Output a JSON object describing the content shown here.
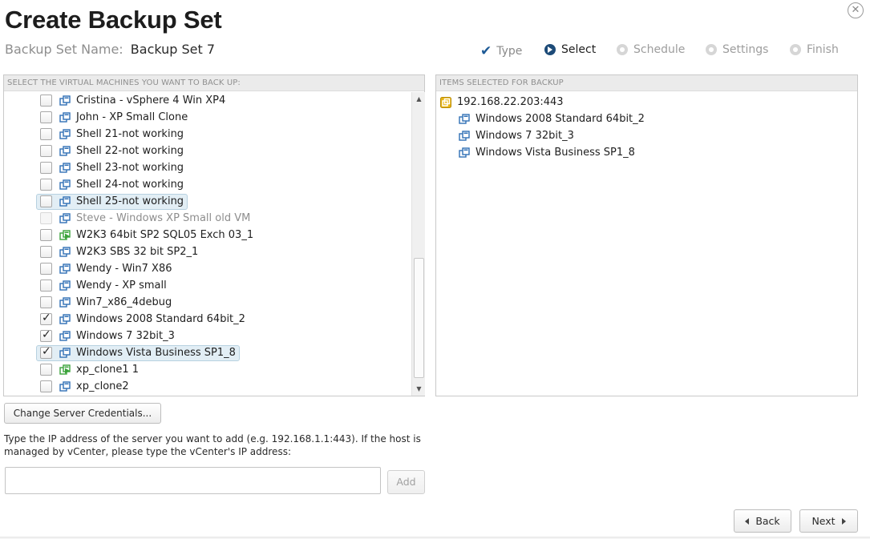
{
  "title": "Create Backup Set",
  "backup_set": {
    "label": "Backup Set Name:",
    "value": "Backup Set 7"
  },
  "steps": [
    {
      "label": "Type",
      "state": "done"
    },
    {
      "label": "Select",
      "state": "active"
    },
    {
      "label": "Schedule",
      "state": "pending"
    },
    {
      "label": "Settings",
      "state": "pending"
    },
    {
      "label": "Finish",
      "state": "pending"
    }
  ],
  "left_panel": {
    "header": "SELECT THE VIRTUAL MACHINES YOU WANT TO BACK UP:",
    "vms": [
      {
        "label": "Cristina - vSphere 4 Win XP4",
        "checked": false,
        "icon": "vm-off-icon",
        "highlight": false,
        "disabled": false
      },
      {
        "label": "John - XP Small Clone",
        "checked": false,
        "icon": "vm-off-icon",
        "highlight": false,
        "disabled": false
      },
      {
        "label": "Shell 21-not working",
        "checked": false,
        "icon": "vm-off-icon",
        "highlight": false,
        "disabled": false
      },
      {
        "label": "Shell 22-not working",
        "checked": false,
        "icon": "vm-off-icon",
        "highlight": false,
        "disabled": false
      },
      {
        "label": "Shell 23-not working",
        "checked": false,
        "icon": "vm-off-icon",
        "highlight": false,
        "disabled": false
      },
      {
        "label": "Shell 24-not working",
        "checked": false,
        "icon": "vm-off-icon",
        "highlight": false,
        "disabled": false
      },
      {
        "label": "Shell 25-not working",
        "checked": false,
        "icon": "vm-off-icon",
        "highlight": true,
        "disabled": false
      },
      {
        "label": "Steve - Windows XP Small old VM",
        "checked": false,
        "icon": "vm-off-icon",
        "highlight": false,
        "disabled": true
      },
      {
        "label": "W2K3 64bit SP2 SQL05 Exch 03_1",
        "checked": false,
        "icon": "vm-running-icon",
        "highlight": false,
        "disabled": false
      },
      {
        "label": "W2K3 SBS 32 bit SP2_1",
        "checked": false,
        "icon": "vm-off-icon",
        "highlight": false,
        "disabled": false
      },
      {
        "label": "Wendy - Win7 X86",
        "checked": false,
        "icon": "vm-off-icon",
        "highlight": false,
        "disabled": false
      },
      {
        "label": "Wendy - XP small",
        "checked": false,
        "icon": "vm-off-icon",
        "highlight": false,
        "disabled": false
      },
      {
        "label": "Win7_x86_4debug",
        "checked": false,
        "icon": "vm-off-icon",
        "highlight": false,
        "disabled": false
      },
      {
        "label": "Windows 2008 Standard 64bit_2",
        "checked": true,
        "icon": "vm-off-icon",
        "highlight": false,
        "disabled": false
      },
      {
        "label": "Windows 7 32bit_3",
        "checked": true,
        "icon": "vm-off-icon",
        "highlight": false,
        "disabled": false
      },
      {
        "label": "Windows Vista Business SP1_8",
        "checked": true,
        "icon": "vm-off-icon",
        "highlight": true,
        "disabled": false
      },
      {
        "label": "xp_clone1 1",
        "checked": false,
        "icon": "vm-running-icon",
        "highlight": false,
        "disabled": false
      },
      {
        "label": "xp_clone2",
        "checked": false,
        "icon": "vm-off-icon",
        "highlight": false,
        "disabled": false
      }
    ]
  },
  "right_panel": {
    "header": "ITEMS SELECTED FOR BACKUP",
    "host": "192.168.22.203:443",
    "items": [
      "Windows 2008 Standard 64bit_2",
      "Windows 7 32bit_3",
      "Windows Vista Business SP1_8"
    ]
  },
  "buttons": {
    "change_credentials": "Change Server Credentials...",
    "add": "Add",
    "back": "Back",
    "next": "Next"
  },
  "hint_text": "Type the IP address of the server you want to add (e.g. 192.168.1.1:443). If the host is managed by vCenter, please type the vCenter's IP address:",
  "server_input": {
    "value": "",
    "placeholder": ""
  },
  "colors": {
    "accent": "#1d4b78",
    "highlight_bg": "#e2eef5",
    "vm_icon_blue": "#2f6fb5",
    "vm_icon_green": "#3aa33a",
    "host_icon": "#e8b412"
  }
}
